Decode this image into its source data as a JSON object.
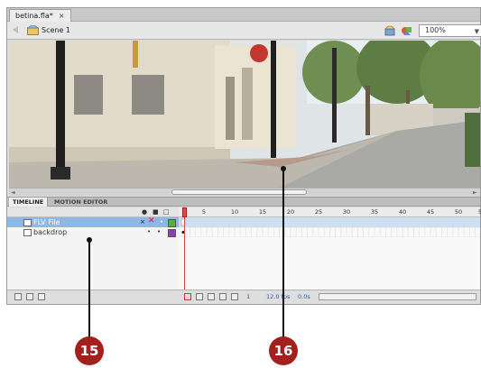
{
  "document_tab": {
    "title": "betina.fla*",
    "close": "×"
  },
  "editbar": {
    "scene_label": "Scene 1",
    "zoom": "100%"
  },
  "panel_tabs": [
    "TIMELINE",
    "MOTION EDITOR"
  ],
  "frame_ruler": [
    "5",
    "10",
    "15",
    "20",
    "25",
    "30",
    "35",
    "40",
    "45",
    "50",
    "5"
  ],
  "layers": [
    {
      "name": "FLV File",
      "selected": true
    },
    {
      "name": "backdrop",
      "selected": false
    }
  ],
  "status_bar": {
    "frame": "1",
    "fps": "12.0 fps",
    "time": "0.0s"
  },
  "callouts": {
    "c15": "15",
    "c16": "16"
  },
  "colors": {
    "callout": "#a3201d",
    "selection": "#8eb6e6",
    "playhead": "#e04a4a"
  },
  "icons": [
    "scene-icon",
    "edit-symbol-icon",
    "edit-scene-icon",
    "eye-icon",
    "lock-icon",
    "outline-icon",
    "layer-icon",
    "new-layer-icon",
    "new-folder-icon",
    "delete-layer-icon"
  ]
}
